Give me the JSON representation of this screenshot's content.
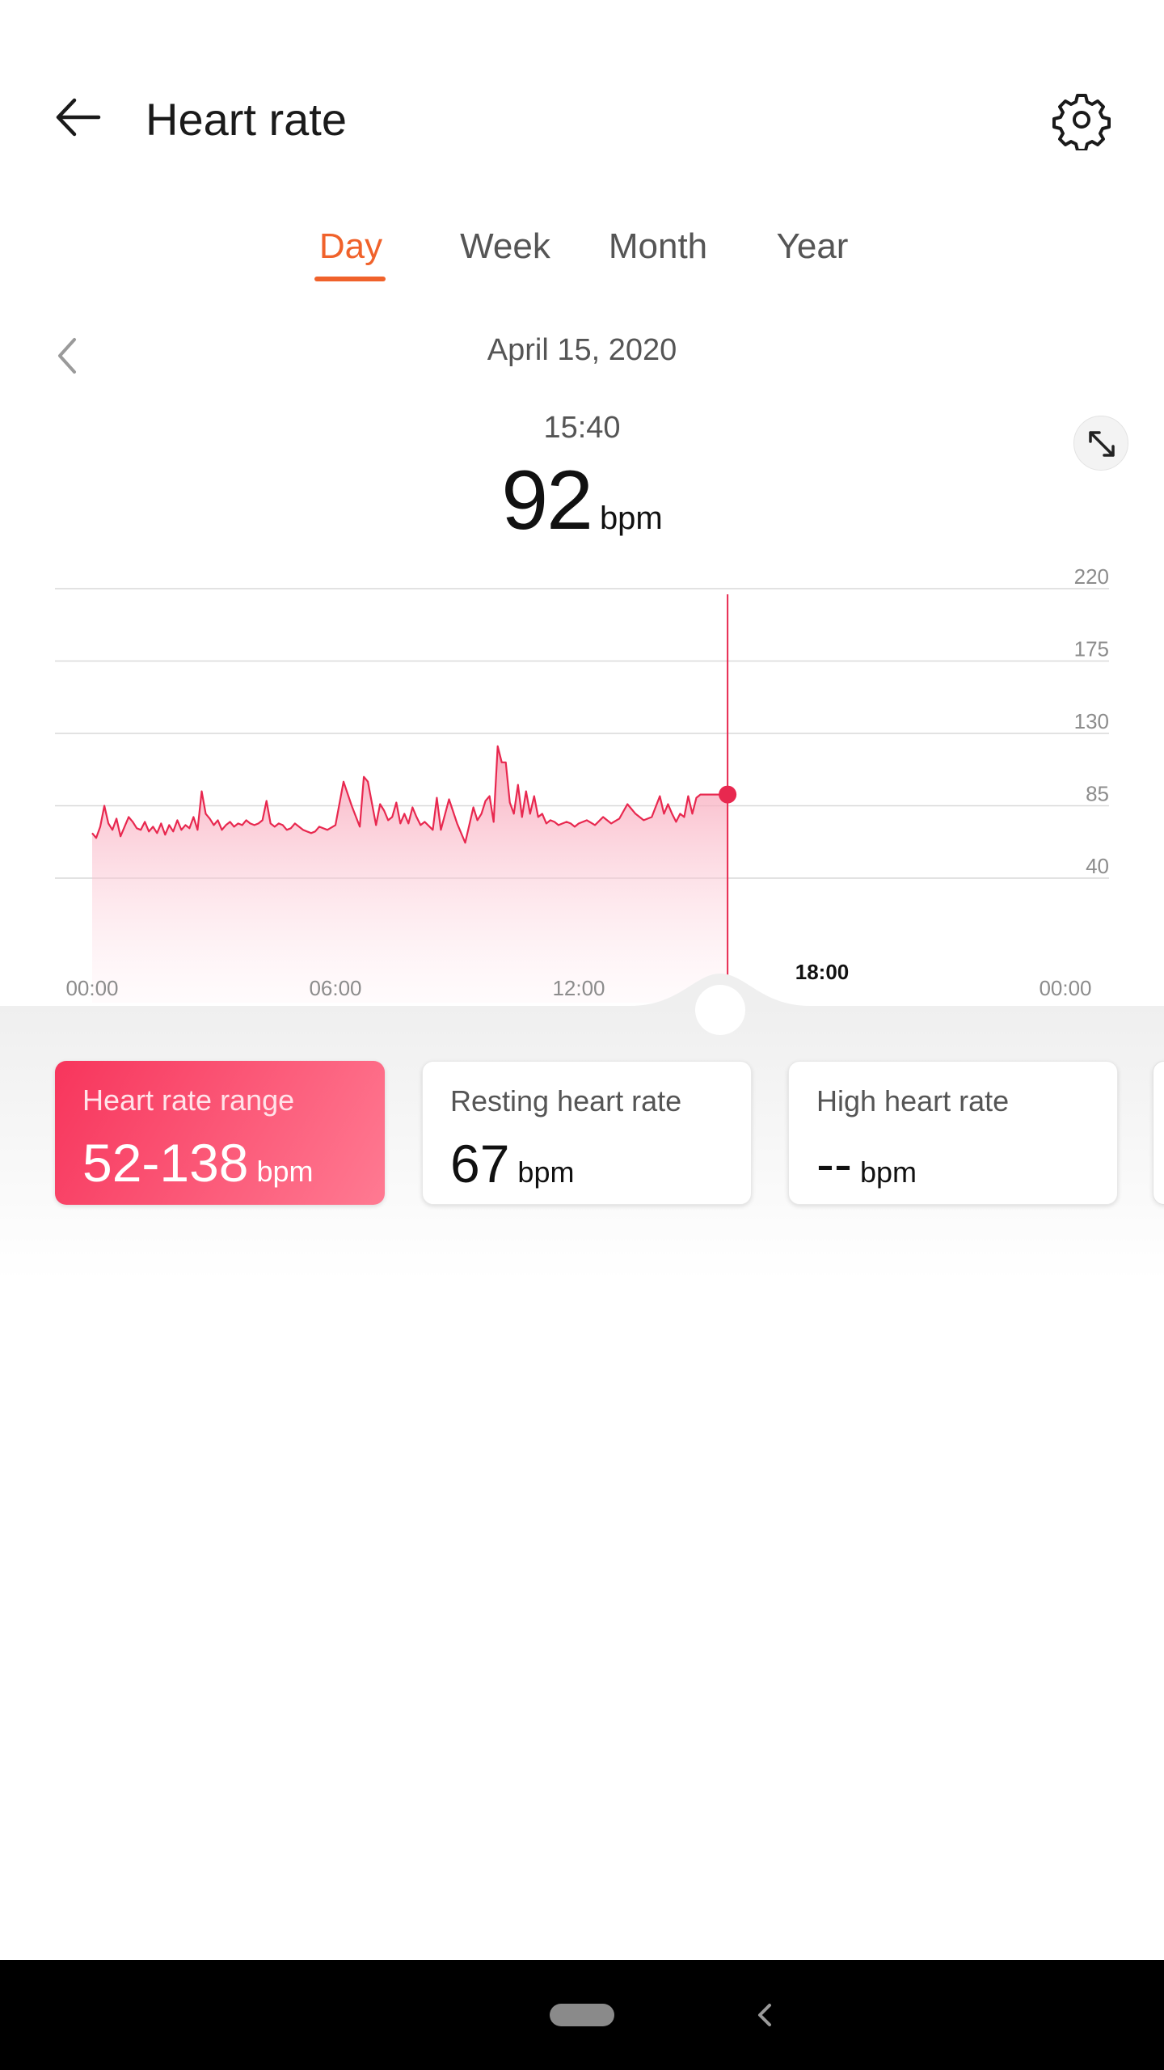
{
  "header": {
    "title": "Heart rate"
  },
  "tabs": [
    {
      "label": "Day",
      "active": true
    },
    {
      "label": "Week",
      "active": false
    },
    {
      "label": "Month",
      "active": false
    },
    {
      "label": "Year",
      "active": false
    }
  ],
  "date": "April 15, 2020",
  "reading": {
    "time": "15:40",
    "value": "92",
    "unit": "bpm"
  },
  "colors": {
    "accent": "#f0622b",
    "heart": "#e8284f",
    "card_gradient_start": "#f7355c",
    "card_gradient_end": "#ff7a92"
  },
  "icons": {
    "back": "arrow-left-icon",
    "settings": "gear-icon",
    "prev": "chevron-left-icon",
    "expand": "expand-icon",
    "nav_back": "chevron-left-icon"
  },
  "chart_data": {
    "type": "area",
    "y_ticks": [
      "220",
      "175",
      "130",
      "85",
      "40"
    ],
    "ylim": [
      40,
      220
    ],
    "x_tick_labels": [
      "00:00",
      "06:00",
      "12:00",
      "18:00",
      "00:00"
    ],
    "x_ticks_hours": [
      0,
      6,
      12,
      18,
      24
    ],
    "xlim_hours": [
      0,
      24
    ],
    "cursor_hour": 15.67,
    "cursor_value": 92,
    "series": [
      {
        "x_hours": [
          0.0,
          0.1,
          0.2,
          0.3,
          0.4,
          0.5,
          0.6,
          0.7,
          0.8,
          0.9,
          1.0,
          1.1,
          1.2,
          1.3,
          1.4,
          1.5,
          1.6,
          1.7,
          1.8,
          1.9,
          2.0,
          2.1,
          2.2,
          2.3,
          2.4,
          2.5,
          2.6,
          2.7,
          2.8,
          2.9,
          3.0,
          3.1,
          3.2,
          3.3,
          3.4,
          3.5,
          3.6,
          3.7,
          3.8,
          3.9,
          4.0,
          4.1,
          4.2,
          4.3,
          4.4,
          4.5,
          4.6,
          4.7,
          4.8,
          4.9,
          5.0,
          5.2,
          5.4,
          5.5,
          5.6,
          5.8,
          6.0,
          6.2,
          6.4,
          6.6,
          6.7,
          6.8,
          7.0,
          7.1,
          7.2,
          7.3,
          7.4,
          7.5,
          7.6,
          7.7,
          7.8,
          7.9,
          8.0,
          8.1,
          8.2,
          8.4,
          8.5,
          8.6,
          8.8,
          9.0,
          9.2,
          9.4,
          9.5,
          9.6,
          9.7,
          9.8,
          9.9,
          10.0,
          10.1,
          10.2,
          10.3,
          10.4,
          10.5,
          10.6,
          10.7,
          10.8,
          10.9,
          11.0,
          11.1,
          11.2,
          11.3,
          11.4,
          11.5,
          11.6,
          11.7,
          11.8,
          11.9,
          12.0,
          12.2,
          12.4,
          12.6,
          12.8,
          13.0,
          13.2,
          13.4,
          13.6,
          13.8,
          14.0,
          14.1,
          14.2,
          14.3,
          14.4,
          14.5,
          14.6,
          14.7,
          14.8,
          14.9,
          15.0,
          15.1,
          15.2,
          15.3,
          15.4,
          15.5,
          15.67
        ],
        "values": [
          68,
          65,
          72,
          85,
          74,
          70,
          77,
          66,
          72,
          78,
          75,
          71,
          70,
          75,
          69,
          72,
          68,
          74,
          67,
          73,
          69,
          76,
          70,
          73,
          71,
          78,
          70,
          94,
          80,
          77,
          73,
          76,
          70,
          73,
          75,
          72,
          74,
          73,
          76,
          74,
          73,
          74,
          76,
          88,
          74,
          72,
          74,
          73,
          70,
          71,
          74,
          70,
          68,
          69,
          72,
          70,
          73,
          100,
          85,
          72,
          103,
          100,
          73,
          86,
          82,
          76,
          78,
          87,
          74,
          80,
          74,
          84,
          78,
          73,
          75,
          70,
          90,
          70,
          89,
          74,
          62,
          84,
          76,
          80,
          88,
          91,
          75,
          122,
          112,
          112,
          87,
          80,
          98,
          78,
          94,
          80,
          91,
          78,
          80,
          74,
          76,
          75,
          73,
          74,
          75,
          74,
          72,
          74,
          76,
          73,
          78,
          74,
          77,
          86,
          80,
          76,
          78,
          91,
          80,
          86,
          80,
          75,
          80,
          78,
          91,
          80,
          90,
          92,
          92,
          92,
          92,
          92,
          92,
          92,
          92,
          92
        ]
      }
    ]
  },
  "cards": [
    {
      "title": "Heart rate range",
      "value": "52-138",
      "unit": "bpm",
      "active": true
    },
    {
      "title": "Resting heart rate",
      "value": "67",
      "unit": "bpm",
      "active": false
    },
    {
      "title": "High heart rate",
      "value": "--",
      "unit": "bpm",
      "active": false
    }
  ]
}
